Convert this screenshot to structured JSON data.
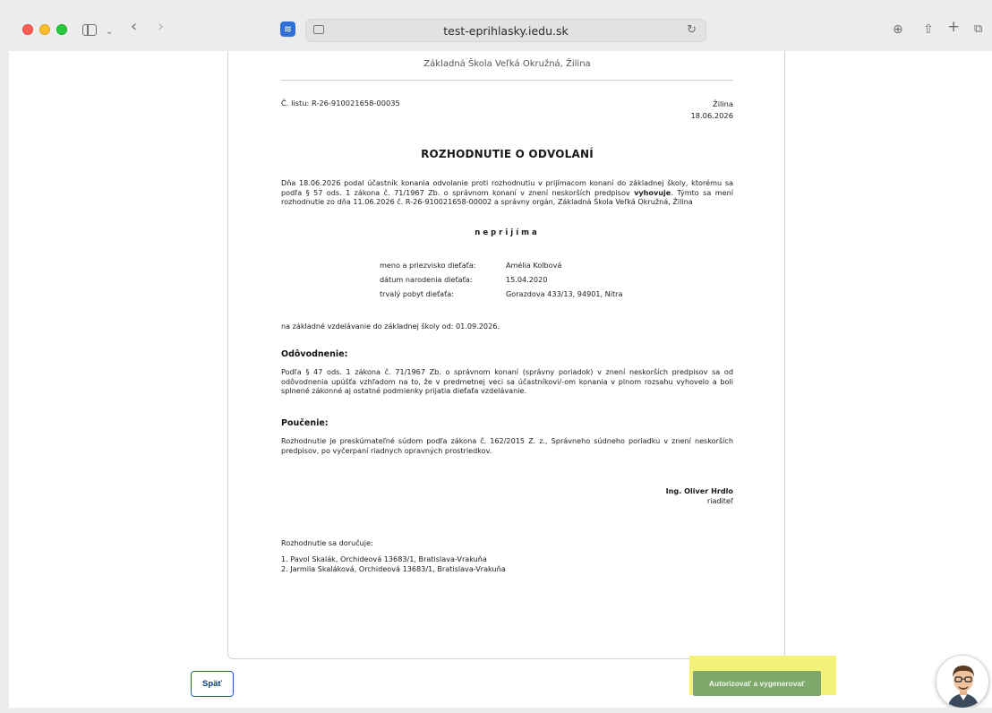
{
  "browser": {
    "url": "test-eprihlasky.iedu.sk"
  },
  "document": {
    "school_name": "Základná Škola Veľká Okružná, Žilina",
    "reference": "Č. listu: R-26-910021658-00035",
    "place": "Žilina",
    "date": "18.06.2026",
    "title": "ROZHODNUTIE O ODVOLANÍ",
    "intro_before": "Dňa 18.06.2026 podal účastník konania odvolanie proti rozhodnutiu v prijímacom konaní do základnej školy, ktorému sa podľa § 57 ods. 1 zákona č. 71/1967 Zb. o správnom konaní v znení neskorších predpisov ",
    "intro_bold": "vyhovuje",
    "intro_after": ". Týmto sa mení rozhodnutie zo dňa 11.06.2026 č. R-26-910021658-00002 a správny orgán, Základná Škola Veľká Okružná, Žilina",
    "decision_word": "neprijíma",
    "child": {
      "name_label": "meno a priezvisko dieťaťa:",
      "name_value": "Amélia Kolbová",
      "birth_label": "dátum narodenia dieťaťa:",
      "birth_value": "15.04.2020",
      "address_label": "trvalý pobyt dieťaťa:",
      "address_value": "Gorazdova 433/13, 94901, Nitra"
    },
    "education_line": "na základné vzdelávanie do základnej školy od: 01.09.2026.",
    "justification_heading": "Odôvodnenie:",
    "justification_text": "Podľa § 47 ods. 1 zákona č. 71/1967 Zb. o správnom konaní (správny poriadok) v znení neskorších predpisov sa od odôvodnenia upúšťa vzhľadom na to, že v predmetnej veci sa účastníkovi/-om konania v plnom rozsahu vyhovelo a boli splnené zákonné aj ostatné podmienky prijatia dieťaťa vzdelávanie.",
    "instruction_heading": "Poučenie:",
    "instruction_text": "Rozhodnutie je preskúmateľné súdom podľa zákona č. 162/2015 Z. z., Správneho súdneho poriadku v znení neskorších predpisov, po vyčerpaní riadnych opravných prostriedkov.",
    "signatory_name": "Ing. Oliver Hrdlo",
    "signatory_role": "riaditeľ",
    "delivery_heading": "Rozhodnutie sa doručuje:",
    "delivery_list": [
      "1.  Pavol Skalák, Orchideová 13683/1, Bratislava-Vrakuňa",
      "2.  Jarmila Skaláková, Orchideová 13683/1, Bratislava-Vrakuňa"
    ]
  },
  "actions": {
    "back_label": "Späť",
    "authorize_label": "Autorizovať a vygenerovať"
  },
  "colors": {
    "authorize_button": "#7fa96c",
    "highlight": "#f5f27a",
    "back_border": "#1d5fb5"
  }
}
